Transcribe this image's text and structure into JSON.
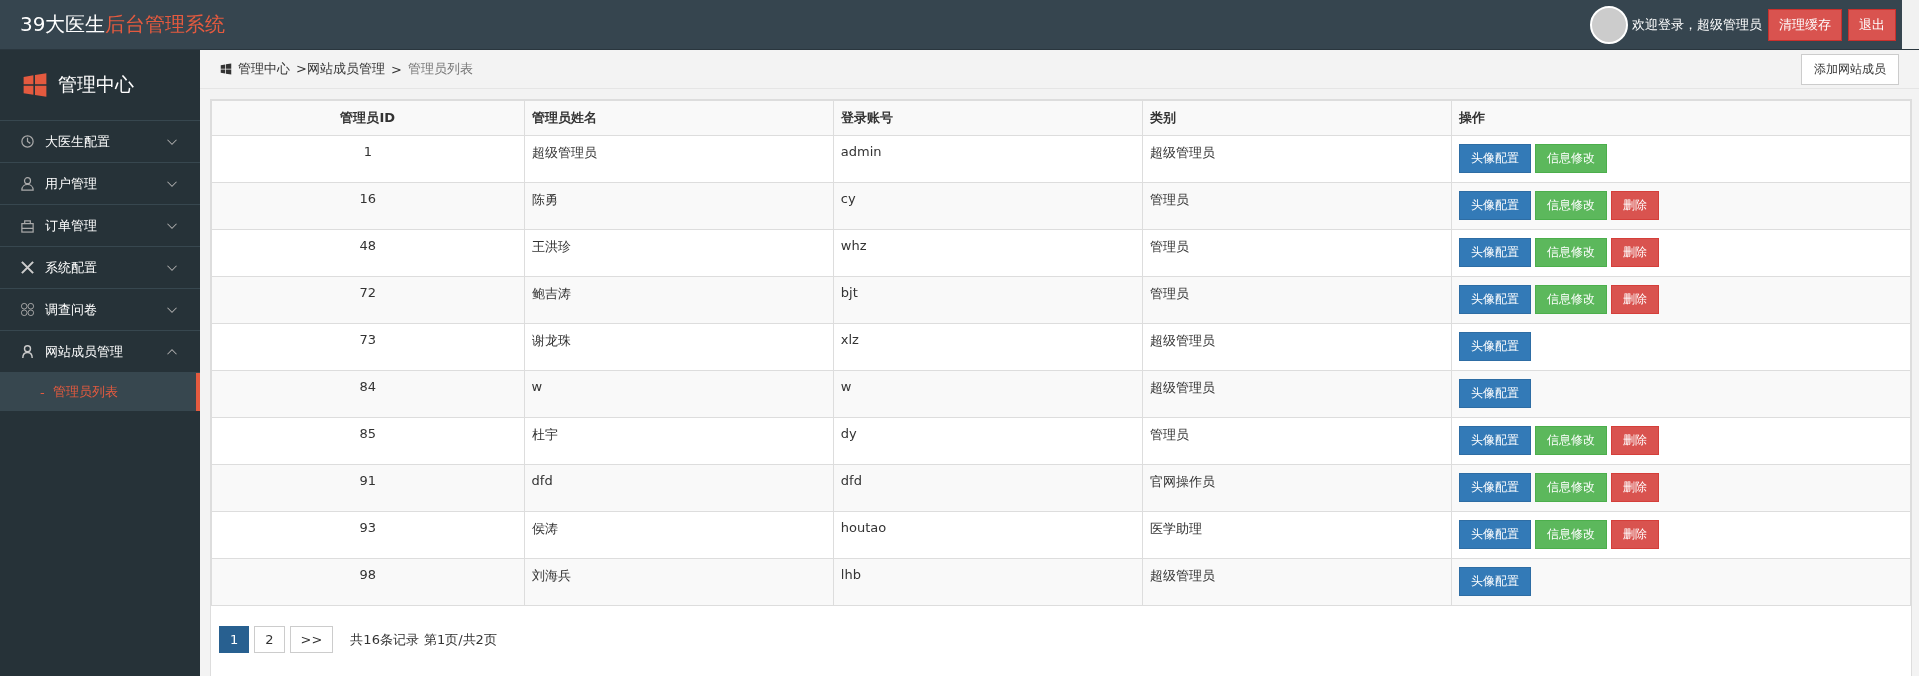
{
  "header": {
    "brand": "39大医生",
    "title": "后台管理系统",
    "welcome": "欢迎登录，超级管理员",
    "buttons": [
      "清理缓存",
      "退出"
    ]
  },
  "sidebar": {
    "title": "管理中心",
    "items": [
      {
        "label": "大医生配置",
        "expanded": false
      },
      {
        "label": "用户管理",
        "expanded": false
      },
      {
        "label": "订单管理",
        "expanded": false
      },
      {
        "label": "系统配置",
        "expanded": false
      },
      {
        "label": "调查问卷",
        "expanded": false
      },
      {
        "label": "网站成员管理",
        "expanded": true,
        "children": [
          {
            "bullet": "-",
            "label": "管理员列表",
            "selected": true
          }
        ]
      }
    ]
  },
  "breadcrumb": {
    "items": [
      "管理中心",
      ">网站成员管理",
      ">",
      "管理员列表"
    ],
    "action": "添加网站成员"
  },
  "table": {
    "columns": [
      "管理员ID",
      "管理员姓名",
      "登录账号",
      "类别",
      "操作"
    ],
    "rows": [
      {
        "id": "1",
        "name": "超级管理员",
        "account": "admin",
        "category": "超级管理员",
        "actions": [
          {
            "label": "头像配置",
            "kind": "primary"
          },
          {
            "label": "信息修改",
            "kind": "success"
          }
        ]
      },
      {
        "id": "16",
        "name": "陈勇",
        "account": "cy",
        "category": "管理员",
        "actions": [
          {
            "label": "头像配置",
            "kind": "primary"
          },
          {
            "label": "信息修改",
            "kind": "success"
          },
          {
            "label": "删除",
            "kind": "danger"
          }
        ]
      },
      {
        "id": "48",
        "name": "王洪珍",
        "account": "whz",
        "category": "管理员",
        "actions": [
          {
            "label": "头像配置",
            "kind": "primary"
          },
          {
            "label": "信息修改",
            "kind": "success"
          },
          {
            "label": "删除",
            "kind": "danger"
          }
        ]
      },
      {
        "id": "72",
        "name": "鲍吉涛",
        "account": "bjt",
        "category": "管理员",
        "actions": [
          {
            "label": "头像配置",
            "kind": "primary"
          },
          {
            "label": "信息修改",
            "kind": "success"
          },
          {
            "label": "删除",
            "kind": "danger"
          }
        ]
      },
      {
        "id": "73",
        "name": "谢龙珠",
        "account": "xlz",
        "category": "超级管理员",
        "actions": [
          {
            "label": "头像配置",
            "kind": "primary"
          }
        ]
      },
      {
        "id": "84",
        "name": "w",
        "account": "w",
        "category": "超级管理员",
        "actions": [
          {
            "label": "头像配置",
            "kind": "primary"
          }
        ]
      },
      {
        "id": "85",
        "name": "杜宇",
        "account": "dy",
        "category": "管理员",
        "actions": [
          {
            "label": "头像配置",
            "kind": "primary"
          },
          {
            "label": "信息修改",
            "kind": "success"
          },
          {
            "label": "删除",
            "kind": "danger"
          }
        ]
      },
      {
        "id": "91",
        "name": "dfd",
        "account": "dfd",
        "category": "官网操作员",
        "actions": [
          {
            "label": "头像配置",
            "kind": "primary"
          },
          {
            "label": "信息修改",
            "kind": "success"
          },
          {
            "label": "删除",
            "kind": "danger"
          }
        ]
      },
      {
        "id": "93",
        "name": "侯涛",
        "account": "houtao",
        "category": "医学助理",
        "actions": [
          {
            "label": "头像配置",
            "kind": "primary"
          },
          {
            "label": "信息修改",
            "kind": "success"
          },
          {
            "label": "删除",
            "kind": "danger"
          }
        ]
      },
      {
        "id": "98",
        "name": "刘海兵",
        "account": "lhb",
        "category": "超级管理员",
        "actions": [
          {
            "label": "头像配置",
            "kind": "primary"
          }
        ]
      }
    ]
  },
  "pagination": {
    "pages": [
      {
        "label": "1",
        "selected": true
      },
      {
        "label": "2",
        "selected": false
      }
    ],
    "next": ">>",
    "summary": "共16条记录",
    "page_info": "第1页/共2页"
  }
}
